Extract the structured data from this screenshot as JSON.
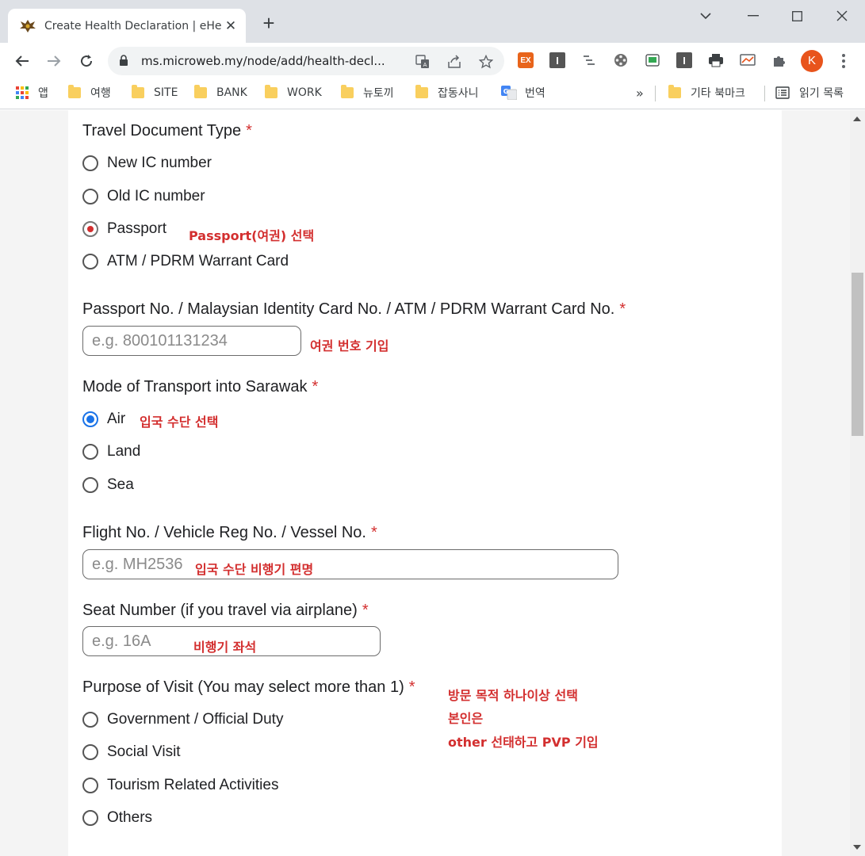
{
  "browser": {
    "tab_title": "Create Health Declaration | eHe",
    "tab_close": "✕",
    "new_tab": "+",
    "url": "ms.microweb.my/node/add/health-decl...",
    "profile_initial": "K",
    "ext_ex_label": "EX",
    "ext_i_label": "I",
    "bookmarks": {
      "apps": "앱",
      "items": [
        "여행",
        "SITE",
        "BANK",
        "WORK",
        "뉴토끼",
        "잡동사니",
        "번역"
      ],
      "more": "»",
      "other": "기타 북마크",
      "reading_list": "읽기 목록"
    }
  },
  "form": {
    "required_mark": "*",
    "travel_doc": {
      "label": "Travel Document Type",
      "options": [
        "New IC number",
        "Old IC number",
        "Passport",
        "ATM / PDRM Warrant Card"
      ],
      "selected": "Passport"
    },
    "passport_no": {
      "label": "Passport No. / Malaysian Identity Card No. / ATM / PDRM Warrant Card No.",
      "placeholder": "e.g. 800101131234"
    },
    "transport": {
      "label": "Mode of Transport into Sarawak",
      "options": [
        "Air",
        "Land",
        "Sea"
      ],
      "selected": "Air"
    },
    "flight_no": {
      "label": "Flight No. / Vehicle Reg No. / Vessel No.",
      "placeholder": "e.g. MH2536"
    },
    "seat_no": {
      "label": "Seat Number (if you travel via airplane)",
      "placeholder": "e.g. 16A"
    },
    "purpose": {
      "label": "Purpose of Visit (You may select more than 1)",
      "options": [
        "Government / Official Duty",
        "Social Visit",
        "Tourism Related Activities",
        "Others"
      ]
    }
  },
  "annotations": {
    "passport": "Passport(여권) 선택",
    "passport_no": "여권 번호 기입",
    "transport": "입국 수단 선택",
    "flight": "입국 수단 비행기 편명",
    "seat": "비행기 좌석",
    "purpose_line1": "방문 목적 하나이상 선택",
    "purpose_line2": "본인은",
    "purpose_line3": "other 선태하고 PVP 기입"
  },
  "colors": {
    "annotation": "#d32f2f",
    "required": "#d32f2f",
    "radio_selected_transport": "#1a73e8",
    "profile": "#e8541c"
  }
}
